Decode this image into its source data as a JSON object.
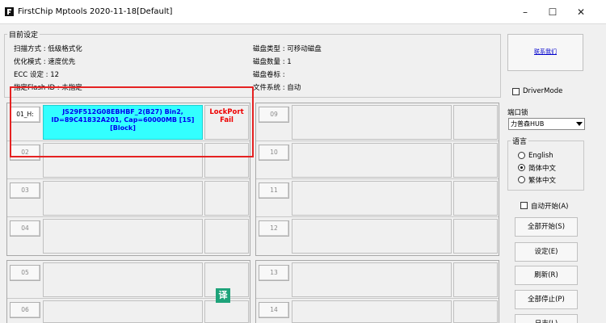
{
  "window": {
    "title": "FirstChip Mptools   2020-11-18[Default]",
    "minimize": "–",
    "maximize": "☐",
    "close": "✕"
  },
  "settings": {
    "group_label": "目前设定",
    "scan_mode": "扫描方式 : 低级格式化",
    "optimize_mode": "优化模式 : 速度优先",
    "ecc": "ECC 设定 : 12",
    "flash_id": "指定Flash ID : 未指定",
    "disk_type": "磁盘类型 : 可移动磁盘",
    "disk_count": "磁盘数量 : 1",
    "disk_label": "磁盘卷标 :",
    "file_system": "文件系统 : 自动"
  },
  "ports": {
    "active": {
      "label": "01_H:",
      "info": "JS29F512G08EBHBF_2(B27)  Bin2, ID=89C41832A201, Cap=60000MB [1S][Block]",
      "status": "LockPort Fail"
    },
    "labels_left": [
      "02",
      "03",
      "04",
      "05",
      "06"
    ],
    "labels_right": [
      "09",
      "10",
      "11",
      "12",
      "13",
      "14"
    ]
  },
  "right_panel": {
    "contact_link": "联系我们",
    "driver_mode": "DriverMode",
    "port_lock_label": "端口锁",
    "port_lock_value": "力普森HUB",
    "language_label": "语言",
    "languages": [
      "English",
      "简体中文",
      "繁体中文"
    ],
    "auto_start": "自动开始(A)",
    "start_all": "全部开始(S)",
    "settings": "设定(E)",
    "refresh": "刷新(R)",
    "stop_all": "全部停止(P)",
    "log": "日志(L)"
  },
  "overlay": {
    "translate_badge": "译"
  }
}
